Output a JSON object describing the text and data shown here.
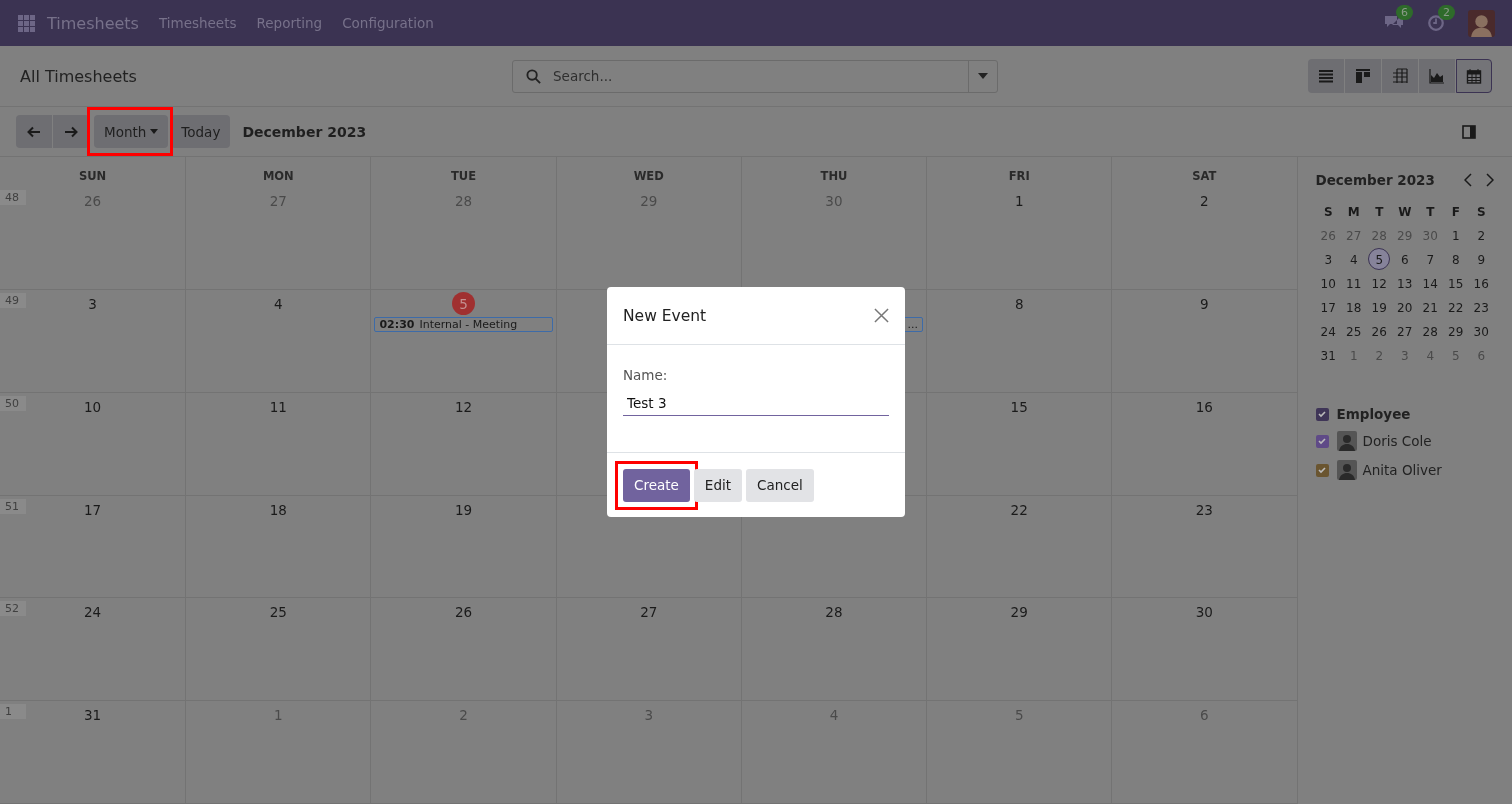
{
  "navbar": {
    "app_name": "Timesheets",
    "menus": [
      "Timesheets",
      "Reporting",
      "Configuration"
    ],
    "messages_badge": "6",
    "activities_badge": "2"
  },
  "control_panel": {
    "title": "All Timesheets",
    "search": {
      "placeholder": "Search..."
    },
    "views": [
      {
        "kind": "list",
        "selected": false
      },
      {
        "kind": "kanban",
        "selected": false
      },
      {
        "kind": "pivot",
        "selected": false
      },
      {
        "kind": "graph",
        "selected": false
      },
      {
        "kind": "calendar",
        "selected": true
      }
    ]
  },
  "toolbar": {
    "scale": "Month",
    "today": "Today",
    "period": "December 2023",
    "scale_highlighted": true
  },
  "calendar": {
    "weekdays": [
      "SUN",
      "MON",
      "TUE",
      "WED",
      "THU",
      "FRI",
      "SAT"
    ],
    "weeks": [
      {
        "number": "48",
        "days": [
          {
            "label": "26",
            "muted": true,
            "today": false
          },
          {
            "label": "27",
            "muted": true,
            "today": false
          },
          {
            "label": "28",
            "muted": true,
            "today": false
          },
          {
            "label": "29",
            "muted": true,
            "today": false
          },
          {
            "label": "30",
            "muted": true,
            "today": false
          },
          {
            "label": "1",
            "muted": false,
            "today": false
          },
          {
            "label": "2",
            "muted": false,
            "today": false
          }
        ]
      },
      {
        "number": "49",
        "days": [
          {
            "label": "3",
            "muted": false,
            "today": false
          },
          {
            "label": "4",
            "muted": false,
            "today": false
          },
          {
            "label": "5",
            "muted": false,
            "today": true,
            "events": [
              {
                "time": "02:30",
                "title": "Internal - Meeting"
              }
            ]
          }
        ],
        "days_after_dialog": [
          {
            "events": [
              {
                "title": "..."
              }
            ]
          },
          {
            "label": "8",
            "muted": false,
            "today": false
          },
          {
            "label": "9",
            "muted": false,
            "today": false
          }
        ]
      },
      {
        "number": "50",
        "days": [
          {
            "label": "10",
            "muted": false,
            "today": false
          },
          {
            "label": "11",
            "muted": false,
            "today": false
          },
          {
            "label": "12",
            "muted": false,
            "today": false
          }
        ],
        "days_after_dialog": [
          {
            "label": "15",
            "muted": false,
            "today": false
          },
          {
            "label": "16",
            "muted": false,
            "today": false
          }
        ]
      },
      {
        "number": "51",
        "days": [
          {
            "label": "17",
            "muted": false,
            "today": false
          },
          {
            "label": "18",
            "muted": false,
            "today": false
          },
          {
            "label": "19",
            "muted": false,
            "today": false
          }
        ],
        "days_after_dialog": [
          {
            "label": "22",
            "muted": false,
            "today": false
          },
          {
            "label": "23",
            "muted": false,
            "today": false
          }
        ]
      },
      {
        "number": "52",
        "days": [
          {
            "label": "24",
            "muted": false,
            "today": false
          },
          {
            "label": "25",
            "muted": false,
            "today": false
          },
          {
            "label": "26",
            "muted": false,
            "today": false
          },
          {
            "label": "27",
            "muted": false,
            "today": false
          },
          {
            "label": "28",
            "muted": false,
            "today": false
          },
          {
            "label": "29",
            "muted": false,
            "today": false
          },
          {
            "label": "30",
            "muted": false,
            "today": false
          }
        ]
      },
      {
        "number": "1",
        "days": [
          {
            "label": "31",
            "muted": false,
            "today": false
          },
          {
            "label": "1",
            "muted": true,
            "today": false
          },
          {
            "label": "2",
            "muted": true,
            "today": false
          },
          {
            "label": "3",
            "muted": true,
            "today": false
          },
          {
            "label": "4",
            "muted": true,
            "today": false
          },
          {
            "label": "5",
            "muted": true,
            "today": false
          },
          {
            "label": "6",
            "muted": true,
            "today": false
          }
        ]
      }
    ]
  },
  "sidebar": {
    "mini_calendar": {
      "title": "December 2023",
      "weekdays": [
        "S",
        "M",
        "T",
        "W",
        "T",
        "F",
        "S"
      ],
      "days": [
        {
          "label": "26",
          "muted": true,
          "selected": false
        },
        {
          "label": "27",
          "muted": true,
          "selected": false
        },
        {
          "label": "28",
          "muted": true,
          "selected": false
        },
        {
          "label": "29",
          "muted": true,
          "selected": false
        },
        {
          "label": "30",
          "muted": true,
          "selected": false
        },
        {
          "label": "1",
          "muted": false,
          "selected": false
        },
        {
          "label": "2",
          "muted": false,
          "selected": false
        },
        {
          "label": "3",
          "muted": false,
          "selected": false
        },
        {
          "label": "4",
          "muted": false,
          "selected": false
        },
        {
          "label": "5",
          "muted": false,
          "selected": true
        },
        {
          "label": "6",
          "muted": false,
          "selected": false
        },
        {
          "label": "7",
          "muted": false,
          "selected": false
        },
        {
          "label": "8",
          "muted": false,
          "selected": false
        },
        {
          "label": "9",
          "muted": false,
          "selected": false
        },
        {
          "label": "10",
          "muted": false,
          "selected": false
        },
        {
          "label": "11",
          "muted": false,
          "selected": false
        },
        {
          "label": "12",
          "muted": false,
          "selected": false
        },
        {
          "label": "13",
          "muted": false,
          "selected": false
        },
        {
          "label": "14",
          "muted": false,
          "selected": false
        },
        {
          "label": "15",
          "muted": false,
          "selected": false
        },
        {
          "label": "16",
          "muted": false,
          "selected": false
        },
        {
          "label": "17",
          "muted": false,
          "selected": false
        },
        {
          "label": "18",
          "muted": false,
          "selected": false
        },
        {
          "label": "19",
          "muted": false,
          "selected": false
        },
        {
          "label": "20",
          "muted": false,
          "selected": false
        },
        {
          "label": "21",
          "muted": false,
          "selected": false
        },
        {
          "label": "22",
          "muted": false,
          "selected": false
        },
        {
          "label": "23",
          "muted": false,
          "selected": false
        },
        {
          "label": "24",
          "muted": false,
          "selected": false
        },
        {
          "label": "25",
          "muted": false,
          "selected": false
        },
        {
          "label": "26",
          "muted": false,
          "selected": false
        },
        {
          "label": "27",
          "muted": false,
          "selected": false
        },
        {
          "label": "28",
          "muted": false,
          "selected": false
        },
        {
          "label": "29",
          "muted": false,
          "selected": false
        },
        {
          "label": "30",
          "muted": false,
          "selected": false
        },
        {
          "label": "31",
          "muted": false,
          "selected": false
        },
        {
          "label": "1",
          "muted": true,
          "selected": false
        },
        {
          "label": "2",
          "muted": true,
          "selected": false
        },
        {
          "label": "3",
          "muted": true,
          "selected": false
        },
        {
          "label": "4",
          "muted": true,
          "selected": false
        },
        {
          "label": "5",
          "muted": true,
          "selected": false
        },
        {
          "label": "6",
          "muted": true,
          "selected": false
        }
      ]
    },
    "filter": {
      "title": "Employee",
      "checked": true,
      "color": "#3f3557",
      "items": [
        {
          "name": "Doris Cole",
          "checked": true,
          "color": "#5f4a87"
        },
        {
          "name": "Anita Oliver",
          "checked": true,
          "color": "#6a5530"
        }
      ]
    }
  },
  "dialog": {
    "title": "New Event",
    "name_label": "Name:",
    "name_value": "Test 3",
    "buttons": [
      {
        "label": "Create",
        "kind": "primary",
        "highlighted": true
      },
      {
        "label": "Edit",
        "kind": "secondary",
        "highlighted": false
      },
      {
        "label": "Cancel",
        "kind": "secondary",
        "highlighted": false
      }
    ]
  }
}
